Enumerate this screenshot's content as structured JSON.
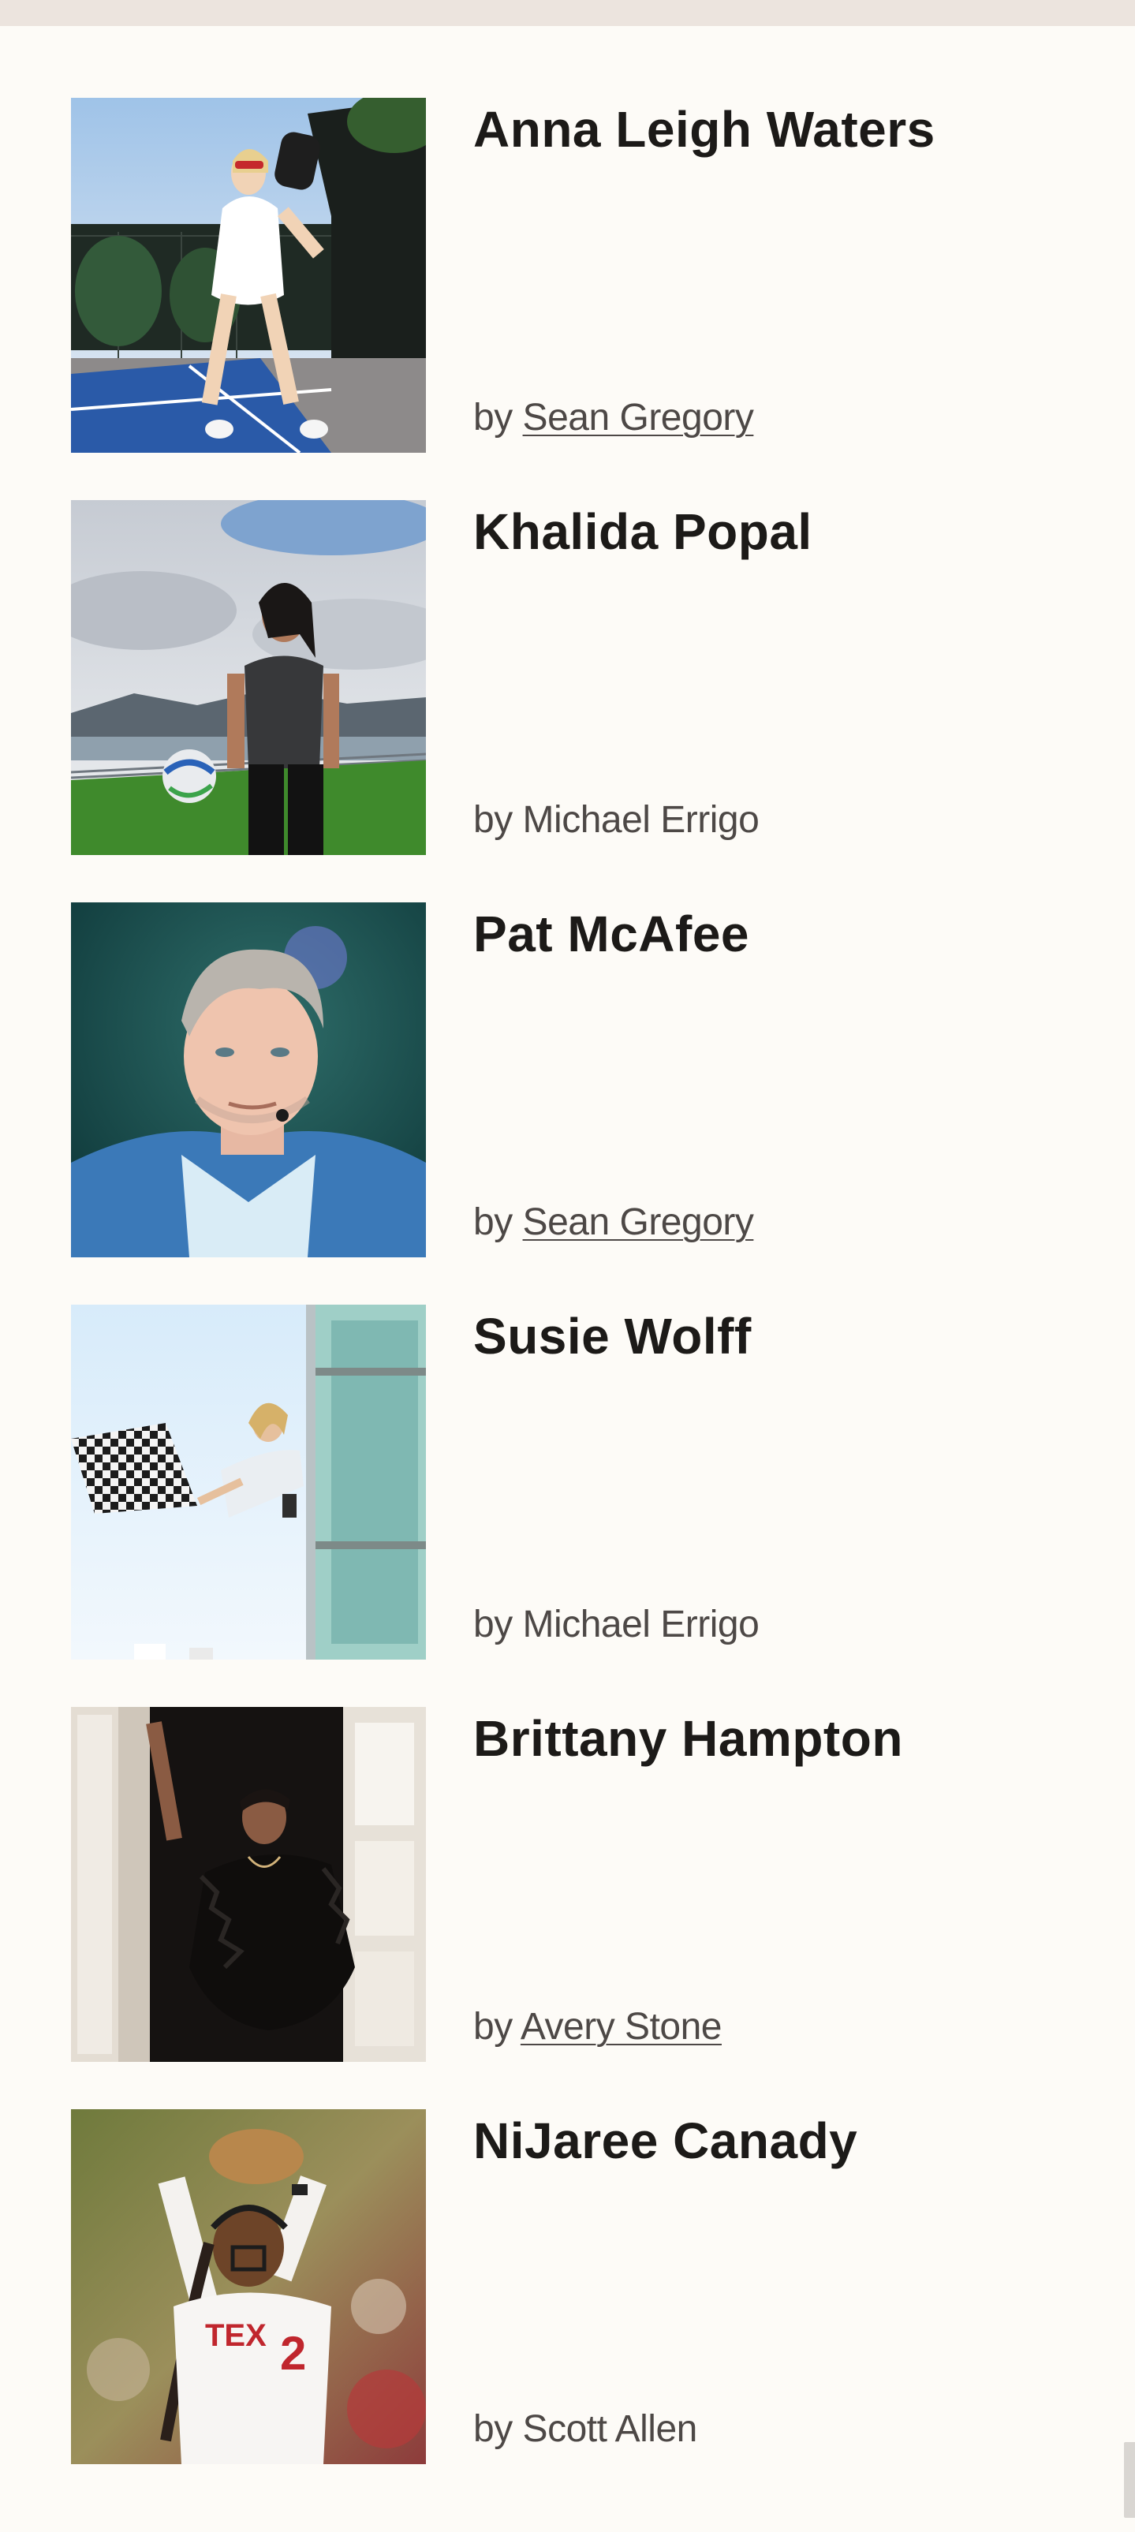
{
  "colors": {
    "background": "#fdfbf7",
    "top_bar": "#ece4de",
    "name_text": "#1c1a18",
    "byline_text": "#4d4846"
  },
  "profiles": [
    {
      "name": "Anna Leigh Waters",
      "by": "by",
      "author": "Sean Gregory",
      "author_linked": true,
      "image": "pickleball-player-photo"
    },
    {
      "name": "Khalida Popal",
      "by": "by",
      "author": "Michael Errigo",
      "author_linked": false,
      "image": "soccer-player-photo"
    },
    {
      "name": "Pat McAfee",
      "by": "by",
      "author": "Sean Gregory",
      "author_linked": true,
      "image": "broadcaster-photo"
    },
    {
      "name": "Susie Wolff",
      "by": "by",
      "author": "Michael Errigo",
      "author_linked": false,
      "image": "checkered-flag-photo"
    },
    {
      "name": "Brittany Hampton",
      "by": "by",
      "author": "Avery Stone",
      "author_linked": true,
      "image": "doorway-portrait-photo"
    },
    {
      "name": "NiJaree Canady",
      "by": "by",
      "author": "Scott Allen",
      "author_linked": false,
      "image": "softball-pitcher-photo"
    }
  ]
}
